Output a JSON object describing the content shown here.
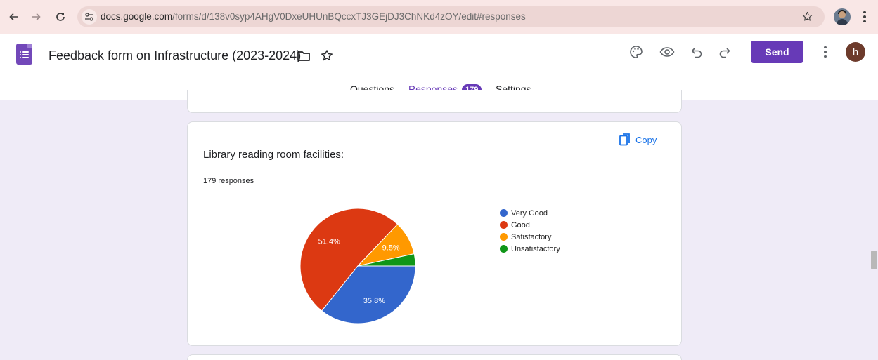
{
  "browser": {
    "url_host": "docs.google.com",
    "url_path": "/forms/d/138v0syp4AHgV0DxeUHUnBQccxTJ3GEjDJ3ChNKd4zOY/edit#responses"
  },
  "header": {
    "title": "Feedback form on Infrastructure (2023-2024)",
    "send_label": "Send",
    "avatar_letter": "h"
  },
  "tabs": [
    {
      "label": "Questions"
    },
    {
      "label": "Responses",
      "badge": "179"
    },
    {
      "label": "Settings"
    }
  ],
  "question": {
    "title": "Library reading room facilities:",
    "responses": "179 responses",
    "copy_label": "Copy"
  },
  "colors": {
    "accent": "#673ab7",
    "link": "#1a73e8"
  },
  "chart_data": {
    "type": "pie",
    "categories": [
      "Very Good",
      "Good",
      "Satisfactory",
      "Unsatisfactory"
    ],
    "values": [
      35.8,
      51.4,
      9.5,
      3.4
    ],
    "data_labels": [
      "35.8%",
      "51.4%",
      "9.5%",
      ""
    ],
    "colors": [
      "#3366cc",
      "#dc3912",
      "#ff9900",
      "#109618"
    ],
    "legend_position": "right"
  }
}
